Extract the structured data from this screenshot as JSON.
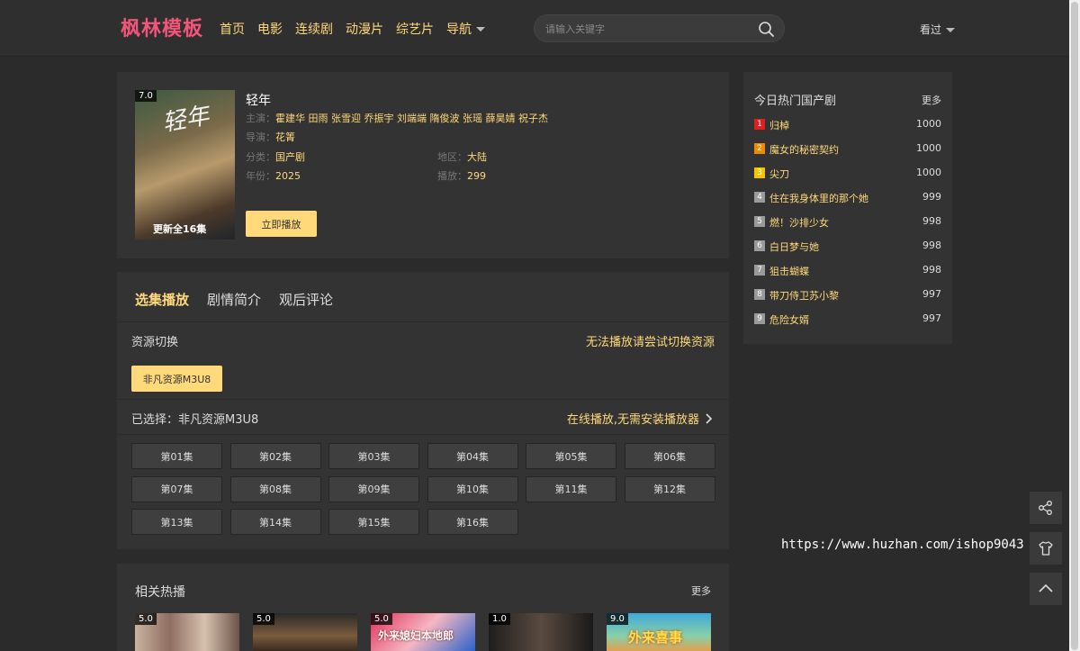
{
  "header": {
    "logo": "枫林模板",
    "nav": [
      "首页",
      "电影",
      "连续剧",
      "动漫片",
      "综艺片",
      "导航"
    ],
    "search_placeholder": "请输入关键字",
    "history_label": "看过"
  },
  "detail": {
    "score": "7.0",
    "poster_title": "轻年",
    "poster_subtitle": "更新全16集",
    "title": "轻年",
    "actors_label": "主演：",
    "actors": "霍建华 田雨 张雪迎 乔振宇 刘端端 隋俊波 张瑶 薛昊婧 祝子杰",
    "director_label": "导演：",
    "director": "花箐",
    "category_label": "分类：",
    "category": "国产剧",
    "region_label": "地区：",
    "region": "大陆",
    "year_label": "年份：",
    "year": "2025",
    "plays_label": "播放：",
    "plays": "299",
    "play_button": "立即播放"
  },
  "episodes": {
    "tabs": [
      "选集播放",
      "剧情简介",
      "观后评论"
    ],
    "source_switch": "资源切换",
    "source_tip": "无法播放请尝试切换资源",
    "source_button": "非凡资源M3U8",
    "selected": "已选择：非凡资源M3U8",
    "online_tip": "在线播放,无需安装播放器",
    "list": [
      "第01集",
      "第02集",
      "第03集",
      "第04集",
      "第05集",
      "第06集",
      "第07集",
      "第08集",
      "第09集",
      "第10集",
      "第11集",
      "第12集",
      "第13集",
      "第14集",
      "第15集",
      "第16集"
    ]
  },
  "related": {
    "title": "相关热播",
    "more": "更多",
    "items": [
      {
        "score": "5.0",
        "text": ""
      },
      {
        "score": "5.0",
        "text": ""
      },
      {
        "score": "5.0",
        "text": "外来媳妇本地郎"
      },
      {
        "score": "1.0",
        "text": ""
      },
      {
        "score": "9.0",
        "text": "外来喜事"
      }
    ]
  },
  "hot": {
    "title": "今日热门国产剧",
    "more": "更多",
    "items": [
      {
        "rank": "1",
        "name": "归棹",
        "count": "1000",
        "color": "#e02020"
      },
      {
        "rank": "2",
        "name": "魔女的秘密契约",
        "count": "1000",
        "color": "#f08a00"
      },
      {
        "rank": "3",
        "name": "尖刀",
        "count": "1000",
        "color": "#f5c400"
      },
      {
        "rank": "4",
        "name": "住在我身体里的那个她",
        "count": "999",
        "color": "#9a9a9a"
      },
      {
        "rank": "5",
        "name": "燃！沙排少女",
        "count": "998",
        "color": "#9a9a9a"
      },
      {
        "rank": "6",
        "name": "白日梦与她",
        "count": "998",
        "color": "#9a9a9a"
      },
      {
        "rank": "7",
        "name": "狙击蝴蝶",
        "count": "998",
        "color": "#9a9a9a"
      },
      {
        "rank": "8",
        "name": "带刀侍卫苏小黎",
        "count": "997",
        "color": "#9a9a9a"
      },
      {
        "rank": "9",
        "name": "危险女婿",
        "count": "997",
        "color": "#9a9a9a"
      }
    ]
  },
  "watermark": "https://www.huzhan.com/ishop9043",
  "colors": {
    "accent": "#ffd97a",
    "logo": "#f2557a",
    "panel": "#333333",
    "background": "#2b2b2b"
  }
}
